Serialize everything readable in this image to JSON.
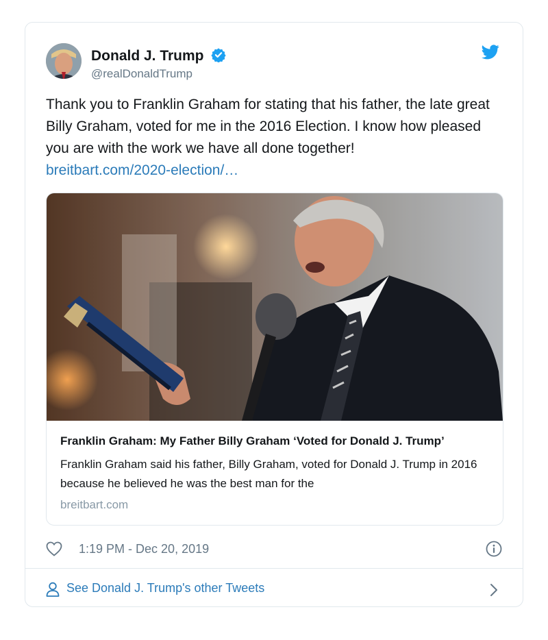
{
  "author": {
    "name": "Donald J. Trump",
    "handle": "@realDonaldTrump"
  },
  "tweet": {
    "text": "Thank you to Franklin Graham for stating that his father, the late great Billy Graham, voted for me in the 2016 Election. I know how pleased you are with the work we have all done together!",
    "link": "breitbart.com/2020-election/…"
  },
  "card": {
    "title": "Franklin Graham: My Father Billy Graham ‘Voted for Donald J. Trump’",
    "description": "Franklin Graham said his father, Billy Graham, voted for Donald J. Trump in 2016 because he believed he was the best man for the",
    "domain": "breitbart.com"
  },
  "meta": {
    "timestamp": "1:19 PM - Dec 20, 2019"
  },
  "footer": {
    "label": "See Donald J. Trump's other Tweets"
  },
  "icons": [
    "verified-badge-icon",
    "twitter-bird-icon",
    "heart-icon",
    "info-icon",
    "person-icon",
    "chevron-right-icon"
  ],
  "colors": {
    "link": "#2b7bb9",
    "verified": "#1da1f2",
    "muted": "#657786",
    "border": "#e1e8ed"
  }
}
